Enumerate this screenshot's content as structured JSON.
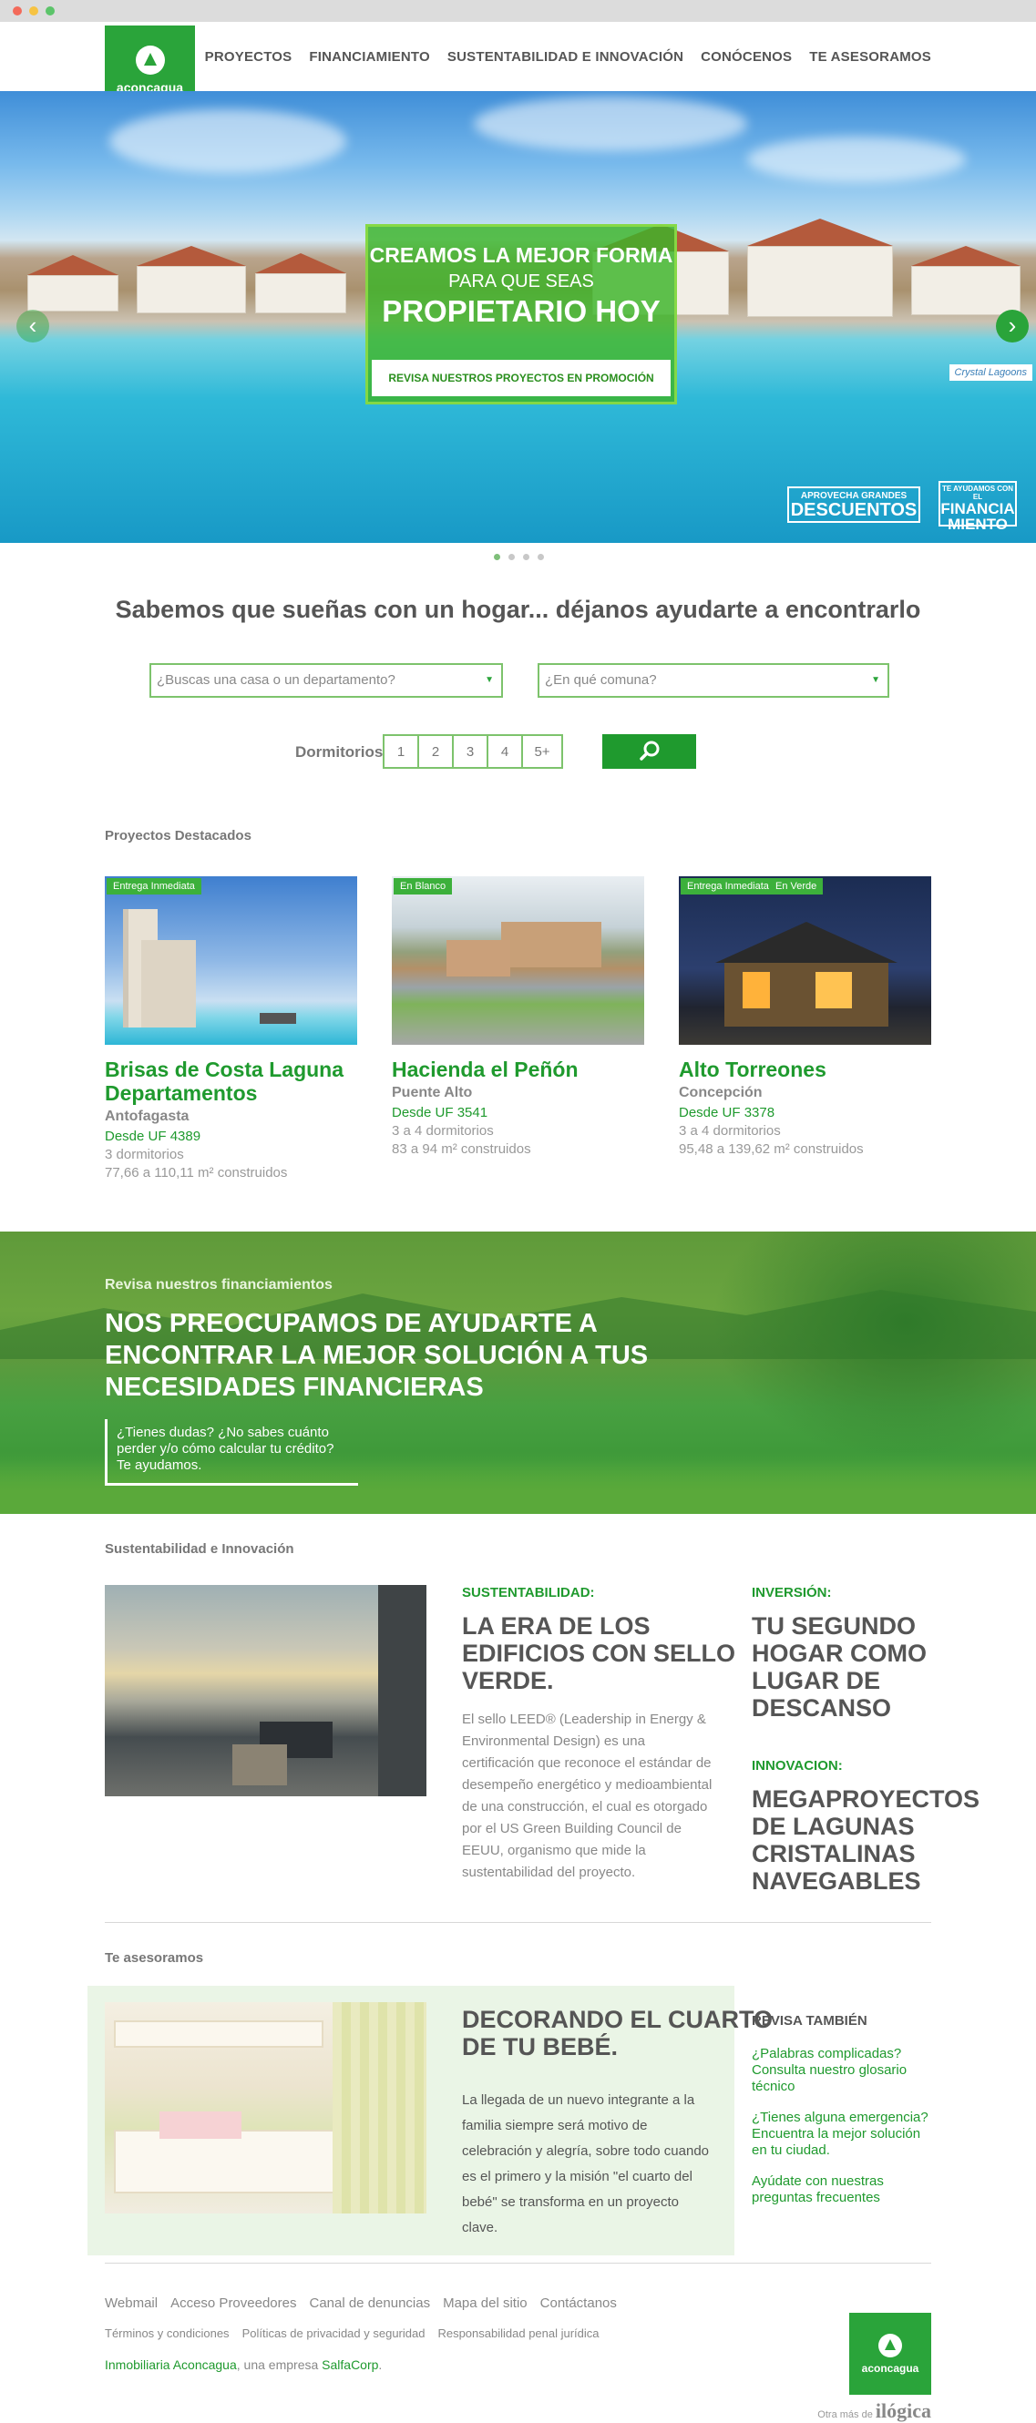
{
  "header": {
    "logo_text": "aconcagua",
    "nav": [
      "PROYECTOS",
      "FINANCIAMIENTO",
      "SUSTENTABILIDAD E INNOVACIÓN",
      "CONÓCENOS",
      "TE ASESORAMOS"
    ]
  },
  "hero": {
    "line1": "CREAMOS LA MEJOR FORMA",
    "line2": "PARA QUE SEAS",
    "line3": "PROPIETARIO HOY",
    "cta": "REVISA NUESTROS PROYECTOS EN PROMOCIÓN",
    "tag": "Crystal Lagoons",
    "badge1_top": "APROVECHA GRANDES",
    "badge1_main": "DESCUENTOS",
    "badge2_top": "TE AYUDAMOS CON EL",
    "badge2_main1": "FINANCIA",
    "badge2_main2": "MIENTO",
    "slides": 4,
    "active_slide": 1
  },
  "search": {
    "tagline": "Sabemos que sueñas con un hogar... déjanos ayudarte a encontrarlo",
    "type_placeholder": "¿Buscas una casa o un departamento?",
    "commune_placeholder": "¿En qué comuna?",
    "dorm_label": "Dormitorios",
    "dorm_options": [
      "1",
      "2",
      "3",
      "4",
      "5+"
    ]
  },
  "featured": {
    "title": "Proyectos Destacados",
    "projects": [
      {
        "chips": [
          "Entrega Inmediata"
        ],
        "name": "Brisas de Costa Laguna Departamentos",
        "city": "Antofagasta",
        "price": "Desde UF 4389",
        "rooms": "3 dormitorios",
        "area": "77,66 a 110,11 m² construidos"
      },
      {
        "chips": [
          "En Blanco"
        ],
        "name": "Hacienda el Peñón",
        "city": "Puente Alto",
        "price": "Desde UF 3541",
        "rooms": "3 a 4 dormitorios",
        "area": "83 a 94 m² construidos"
      },
      {
        "chips": [
          "Entrega Inmediata",
          "En Verde"
        ],
        "name": "Alto Torreones",
        "city": "Concepción",
        "price": "Desde UF 3378",
        "rooms": "3 a 4 dormitorios",
        "area": "95,48 a 139,62 m² construidos"
      }
    ]
  },
  "finance": {
    "subtitle": "Revisa nuestros financiamientos",
    "headline": [
      "NOS PREOCUPAMOS DE AYUDARTE A",
      "ENCONTRAR LA MEJOR SOLUCIÓN A TUS",
      "NECESIDADES FINANCIERAS"
    ],
    "ask": "¿Tienes dudas? ¿No sabes cuánto perder y/o cómo calcular tu crédito? Te ayudamos."
  },
  "sustainability": {
    "title": "Sustentabilidad e Innovación",
    "kicker1": "SUSTENTABILIDAD:",
    "head1": [
      "LA ERA DE LOS",
      "EDIFICIOS CON SELLO",
      "VERDE."
    ],
    "body1": "El sello LEED® (Leadership in Energy & Environmental Design) es una certificación que reconoce el estándar de desempeño energético y medioambiental de una construcción, el cual es otorgado por el US Green Building Council de EEUU, organismo que mide la sustentabilidad del proyecto.",
    "kicker2": "INVERSIÓN:",
    "head2": [
      "TU SEGUNDO",
      "HOGAR COMO",
      "LUGAR DE",
      "DESCANSO"
    ],
    "kicker3": "INNOVACION:",
    "head3": [
      "MEGAPROYECTOS",
      "DE LAGUNAS",
      "CRISTALINAS",
      "NAVEGABLES"
    ]
  },
  "advise": {
    "title": "Te asesoramos",
    "head": [
      "DECORANDO EL CUARTO",
      "DE TU BEBÉ."
    ],
    "body": "La llegada de un nuevo integrante a la familia siempre será motivo de celebración y alegría, sobre todo cuando es el primero y la misión \"el cuarto del bebé\" se transforma en un proyecto clave.",
    "also_title": "REVISA TAMBIÉN",
    "links": [
      "¿Palabras complicadas? Consulta nuestro glosario técnico",
      "¿Tienes alguna emergencia? Encuentra la mejor solución en tu ciudad.",
      "Ayúdate con nuestras preguntas frecuentes"
    ]
  },
  "footer": {
    "row1": [
      "Webmail",
      "Acceso Proveedores",
      "Canal de denuncias",
      "Mapa del sitio",
      "Contáctanos"
    ],
    "row2": [
      "Términos y condiciones",
      "Políticas de privacidad y seguridad",
      "Responsabilidad penal jurídica"
    ],
    "company_link": "Inmobiliaria Aconcagua",
    "company_rest": ", una empresa ",
    "group_link": "SalfaCorp",
    "credit_pre": "Otra más de",
    "credit_brand": "ilógica",
    "logo_text": "aconcagua"
  },
  "colors": {
    "brand_green": "#2aa43a",
    "text_green": "#1f9a2e",
    "gray": "#555555"
  }
}
